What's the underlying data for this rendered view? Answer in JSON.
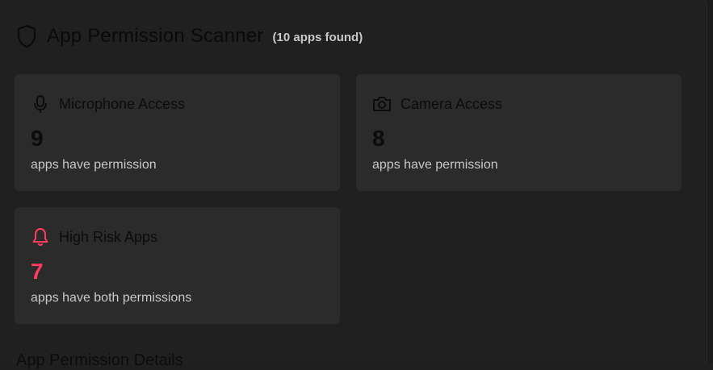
{
  "header": {
    "title": "App Permission Scanner",
    "count": "(10 apps found)"
  },
  "cards": [
    {
      "title": "Microphone Access",
      "value": "9",
      "subtitle": "apps have permission",
      "icon": "microphone-icon"
    },
    {
      "title": "Camera Access",
      "value": "8",
      "subtitle": "apps have permission",
      "icon": "camera-icon"
    },
    {
      "title": "High Risk Apps",
      "value": "7",
      "subtitle": "apps have both permissions",
      "icon": "bell-icon"
    }
  ],
  "section": {
    "title": "App Permission Details"
  },
  "colors": {
    "background": "#202020",
    "card": "#2b2b2b",
    "risk": "#ff3b60",
    "muted_text": "#c8c8c8"
  }
}
